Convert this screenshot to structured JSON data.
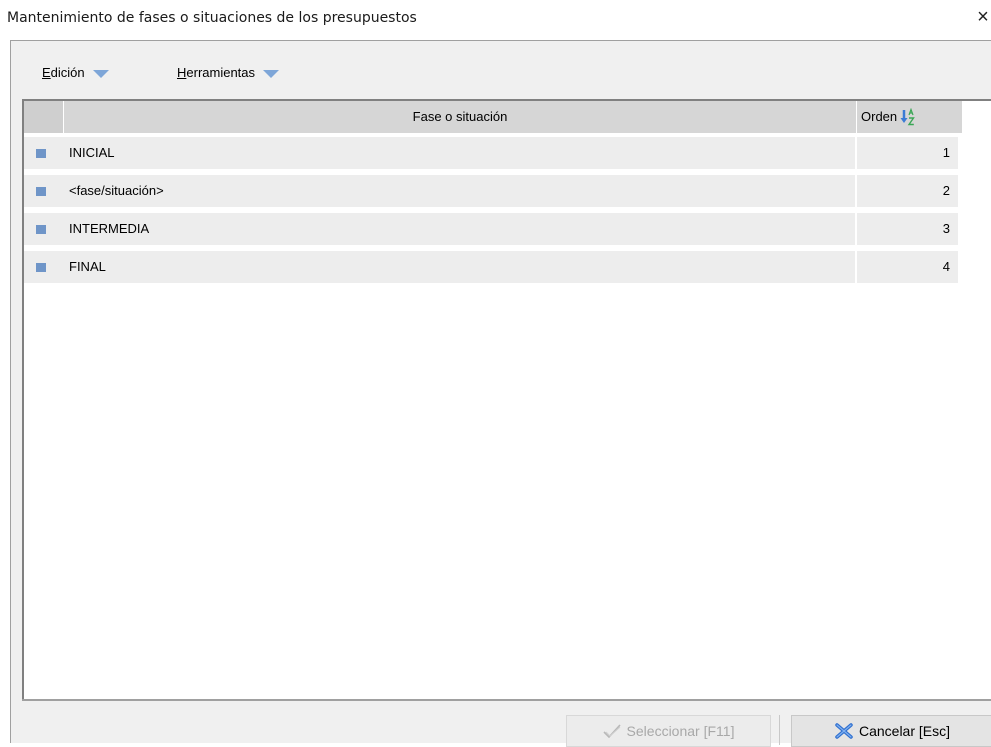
{
  "window": {
    "title": "Mantenimiento de fases o situaciones de los presupuestos",
    "close_glyph": "×"
  },
  "menu": {
    "items": [
      {
        "label_underlined": "E",
        "label_rest": "dición",
        "icon": "dropdown-triangle-icon"
      },
      {
        "label_underlined": "H",
        "label_rest": "erramientas",
        "icon": "dropdown-triangle-icon"
      }
    ]
  },
  "grid": {
    "columns": {
      "fase": "Fase o situación",
      "orden": "Orden",
      "orden_sort_icon": "sort-az-icon"
    },
    "rows": [
      {
        "fase": "INICIAL",
        "orden": "1"
      },
      {
        "fase": "<fase/situación>",
        "orden": "2"
      },
      {
        "fase": "INTERMEDIA",
        "orden": "3"
      },
      {
        "fase": "FINAL",
        "orden": "4"
      }
    ]
  },
  "footer": {
    "select_label": "Seleccionar [F11]",
    "select_icon": "checkmark-icon",
    "select_enabled": false,
    "cancel_label": "Cancelar [Esc]",
    "cancel_icon": "x-cross-icon"
  },
  "colors": {
    "accent_blue": "#6f95c8",
    "cancel_icon_blue": "#2f6fcf",
    "sort_icon_blue": "#3a7bd5",
    "sort_icon_green": "#3aa655"
  }
}
